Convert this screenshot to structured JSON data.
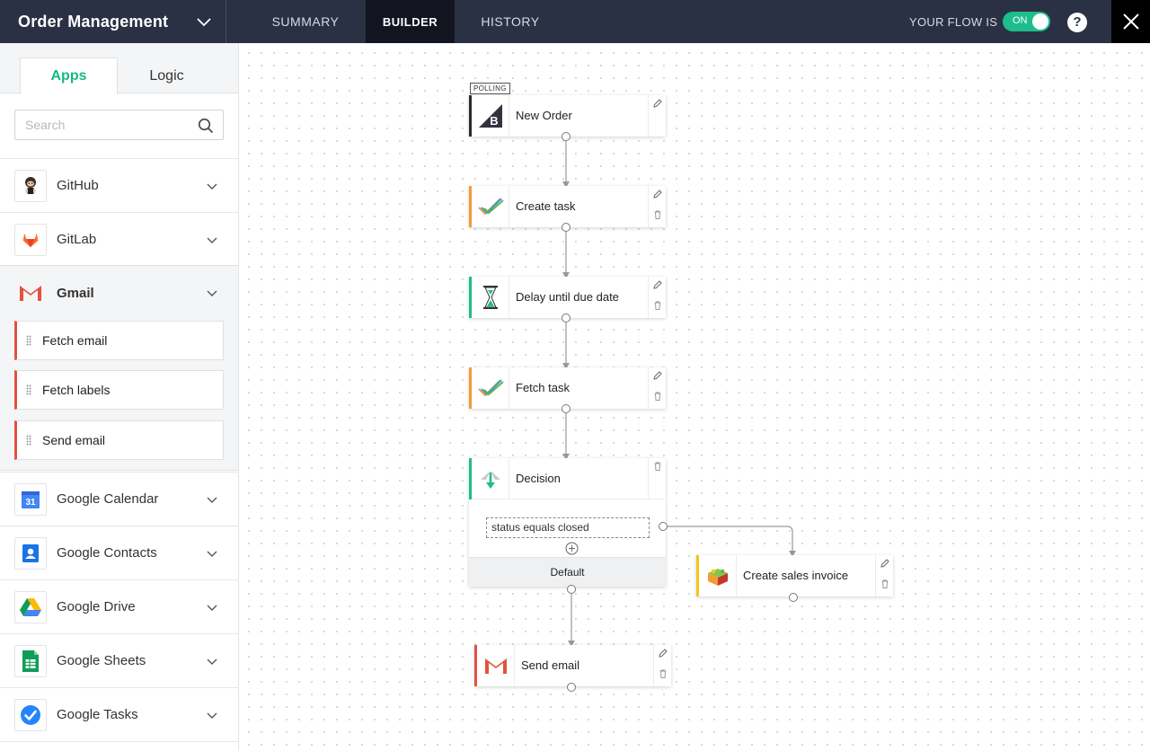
{
  "header": {
    "app_title": "Order Management",
    "tabs": [
      {
        "label": "SUMMARY"
      },
      {
        "label": "BUILDER"
      },
      {
        "label": "HISTORY"
      }
    ],
    "flow_status_label": "YOUR FLOW IS",
    "toggle_text": "ON",
    "help_label": "?"
  },
  "sidebar": {
    "tabs": [
      {
        "label": "Apps"
      },
      {
        "label": "Logic"
      }
    ],
    "search_placeholder": "Search",
    "apps": [
      {
        "name": "GitHub"
      },
      {
        "name": "GitLab"
      },
      {
        "name": "Gmail"
      },
      {
        "name": "Google Calendar"
      },
      {
        "name": "Google Contacts"
      },
      {
        "name": "Google Drive"
      },
      {
        "name": "Google Sheets"
      },
      {
        "name": "Google Tasks"
      }
    ],
    "gmail_actions": [
      {
        "label": "Fetch email"
      },
      {
        "label": "Fetch labels"
      },
      {
        "label": "Send email"
      }
    ],
    "calendar_icon_text": "31"
  },
  "canvas": {
    "polling_badge": "POLLING",
    "nodes": [
      {
        "label": "New Order",
        "icon": "bigcommerce-icon"
      },
      {
        "label": "Create task",
        "icon": "tasks-check-icon",
        "accent": "#f39c34"
      },
      {
        "label": "Delay until due date",
        "icon": "hourglass-icon",
        "accent": "#1dbd8e"
      },
      {
        "label": "Fetch task",
        "icon": "tasks-check-icon",
        "accent": "#f39c34"
      },
      {
        "label": "Create sales invoice",
        "icon": "invoice-app-icon",
        "accent": "#f5c518"
      },
      {
        "label": "Send email",
        "icon": "gmail-icon",
        "accent": "#e2523f"
      }
    ],
    "decision": {
      "label": "Decision",
      "condition": "status equals closed",
      "default_label": "Default",
      "accent": "#1dbd8e"
    }
  },
  "colors": {
    "topbar": "#2b3144",
    "active_tab": "#12151f",
    "brand_green": "#16b886",
    "toggle_on": "#1dbd8e"
  }
}
